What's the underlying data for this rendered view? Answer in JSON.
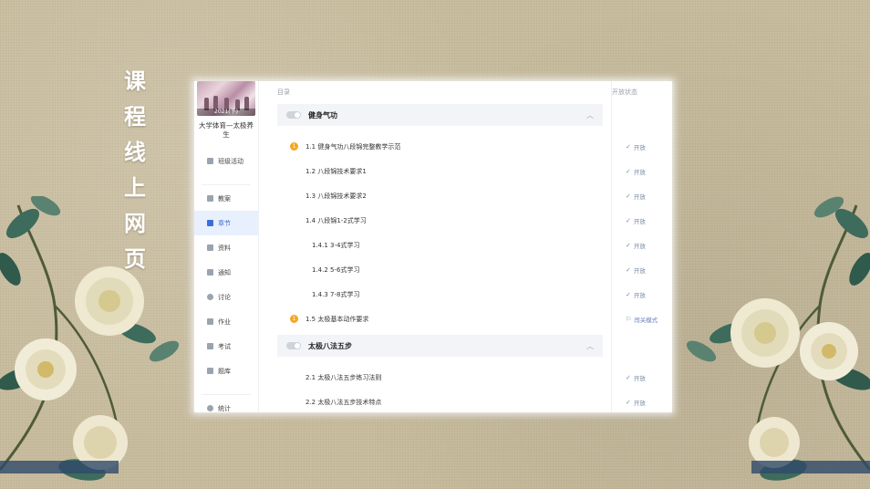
{
  "page_title_chars": [
    "课",
    "程",
    "线",
    "上",
    "网",
    "页"
  ],
  "sidebar": {
    "course_image_caption": "2021(下)",
    "course_name": "大学体育—太极养生",
    "items": [
      {
        "label": "班级活动",
        "icon": "grid-icon",
        "active": false
      },
      {
        "label": "教案",
        "icon": "document-icon",
        "active": false
      },
      {
        "label": "章节",
        "icon": "list-icon",
        "active": true
      },
      {
        "label": "资料",
        "icon": "folder-icon",
        "active": false
      },
      {
        "label": "通知",
        "icon": "speaker-icon",
        "active": false
      },
      {
        "label": "讨论",
        "icon": "chat-icon",
        "active": false
      },
      {
        "label": "作业",
        "icon": "edit-icon",
        "active": false
      },
      {
        "label": "考试",
        "icon": "exam-icon",
        "active": false
      },
      {
        "label": "题库",
        "icon": "layers-icon",
        "active": false
      },
      {
        "label": "统计",
        "icon": "pie-icon",
        "active": false
      }
    ]
  },
  "header": {
    "catalog": "目录",
    "status": "开放状态"
  },
  "chapters": [
    {
      "title": "健身气功",
      "sections": [
        {
          "num": "1.1",
          "title": "健身气功八段锦完整教学示范",
          "badge": "1",
          "level": "badge",
          "status": "开放"
        },
        {
          "num": "1.2",
          "title": "八段锦技术要求1",
          "level": "1",
          "status": "开放"
        },
        {
          "num": "1.3",
          "title": "八段锦技术要求2",
          "level": "1",
          "status": "开放"
        },
        {
          "num": "1.4",
          "title": "八段锦1-2式学习",
          "level": "1",
          "status": "开放"
        },
        {
          "num": "1.4.1",
          "title": "3-4式学习",
          "level": "2",
          "status": "开放"
        },
        {
          "num": "1.4.2",
          "title": "5-6式学习",
          "level": "2",
          "status": "开放"
        },
        {
          "num": "1.4.3",
          "title": "7-8式学习",
          "level": "2",
          "status": "开放"
        },
        {
          "num": "1.5",
          "title": "太极基本动作要求",
          "badge": "1",
          "level": "badge",
          "status": "闯关模式"
        }
      ]
    },
    {
      "title": "太极八法五步",
      "sections": [
        {
          "num": "2.1",
          "title": "太极八法五步练习法则",
          "level": "1",
          "status": "开放"
        },
        {
          "num": "2.2",
          "title": "太极八法五步技术特点",
          "level": "1",
          "status": "开放"
        }
      ]
    }
  ],
  "colors": {
    "accent": "#3a6fd8",
    "badge": "#f5a623",
    "background": "#c9bd9f"
  }
}
